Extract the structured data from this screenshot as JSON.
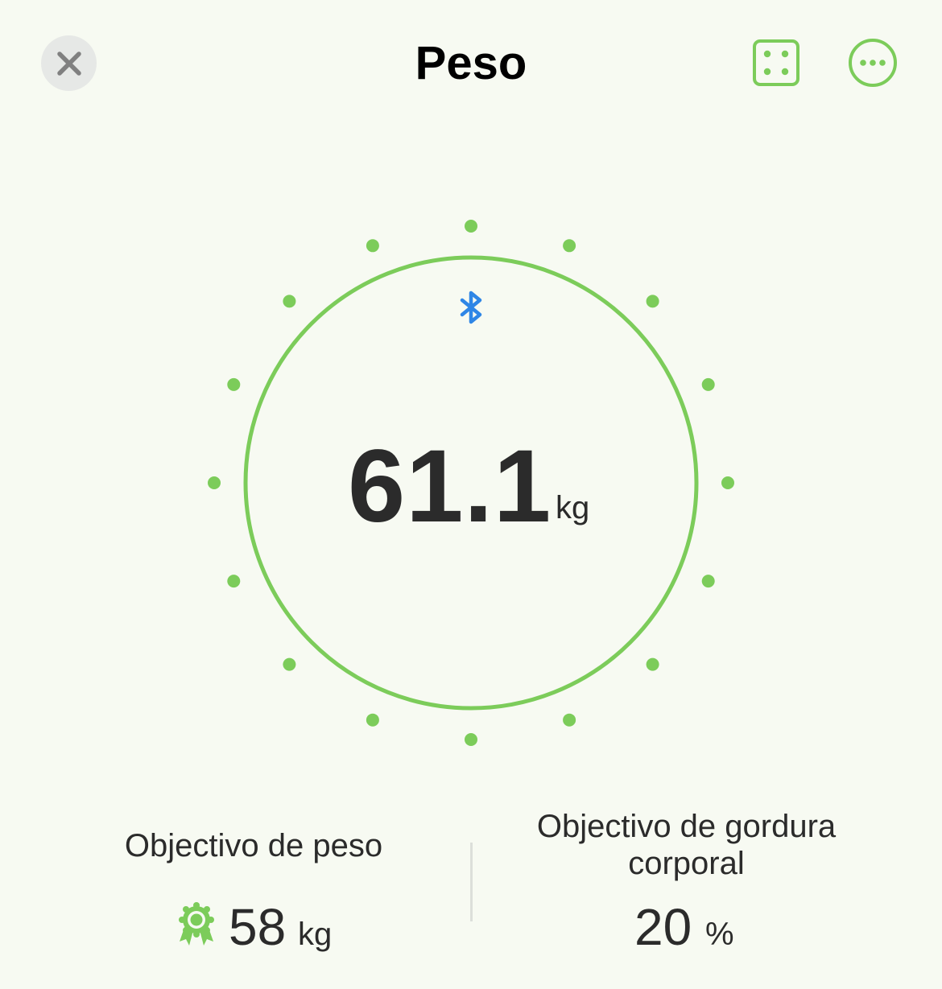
{
  "header": {
    "title": "Peso",
    "close_icon": "close-icon",
    "scan_icon": "scan-frame-icon",
    "more_icon": "more-options-icon"
  },
  "measurement": {
    "value": "61.1",
    "unit": "kg",
    "connection_icon": "bluetooth-icon"
  },
  "goals": {
    "weight": {
      "label": "Objectivo de peso",
      "value": "58",
      "unit": "kg",
      "icon": "award-badge-icon"
    },
    "body_fat": {
      "label": "Objectivo de gordura corporal",
      "value": "20",
      "unit": "%"
    }
  },
  "colors": {
    "accent": "#7ccc5a",
    "bluetooth": "#2f86e6",
    "background": "#f7faf2"
  }
}
